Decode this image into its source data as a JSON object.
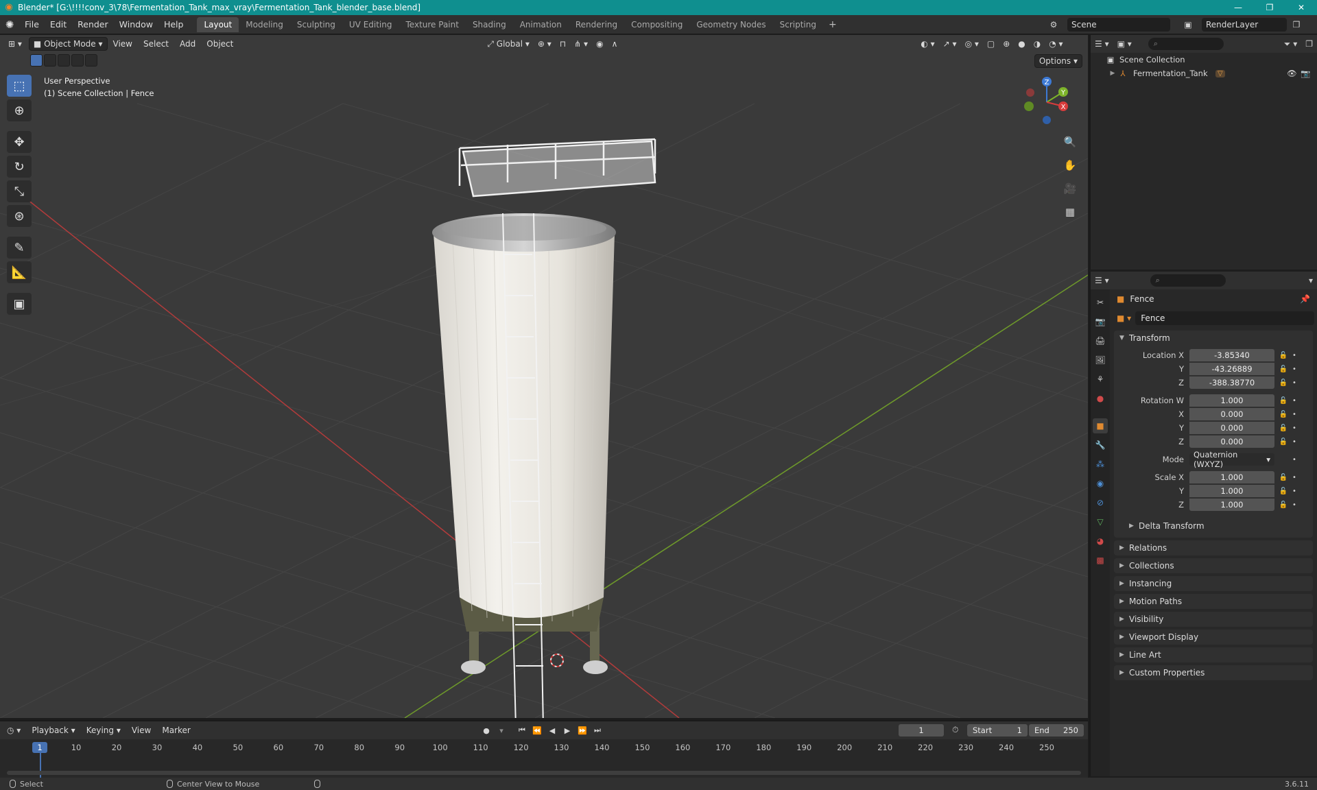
{
  "titlebar": {
    "title": "Blender* [G:\\!!!!conv_3\\78\\Fermentation_Tank_max_vray\\Fermentation_Tank_blender_base.blend]",
    "minimize": "—",
    "maximize": "❐",
    "close": "✕"
  },
  "menubar": {
    "items": [
      "File",
      "Edit",
      "Render",
      "Window",
      "Help"
    ],
    "workspaces": [
      "Layout",
      "Modeling",
      "Sculpting",
      "UV Editing",
      "Texture Paint",
      "Shading",
      "Animation",
      "Rendering",
      "Compositing",
      "Geometry Nodes",
      "Scripting"
    ],
    "add_workspace": "+",
    "scene": "Scene",
    "render_layer": "RenderLayer"
  },
  "viewport": {
    "mode": "Object Mode",
    "menus": [
      "View",
      "Select",
      "Add",
      "Object"
    ],
    "orientation": "Global",
    "options": "Options",
    "perspective": "User Perspective",
    "collection_info": "(1) Scene Collection | Fence",
    "gizmo": {
      "z": "Z",
      "y": "Y",
      "x": "X"
    }
  },
  "outliner": {
    "root": "Scene Collection",
    "items": [
      {
        "name": "Fermentation_Tank"
      }
    ]
  },
  "properties": {
    "object_name": "Fence",
    "data_name": "Fence",
    "transform": {
      "header": "Transform",
      "location_label": "Location X",
      "loc_x": "-3.85340",
      "loc_y": "-43.26889",
      "loc_z": "-388.38770",
      "rotation_label": "Rotation W",
      "rot_w": "1.000",
      "rot_x": "0.000",
      "rot_y": "0.000",
      "rot_z": "0.000",
      "mode_label": "Mode",
      "mode": "Quaternion (WXYZ)",
      "scale_label": "Scale X",
      "scale_x": "1.000",
      "scale_y": "1.000",
      "scale_z": "1.000",
      "y_label": "Y",
      "z_label": "Z",
      "x_label": "X",
      "delta": "Delta Transform"
    },
    "panels": [
      "Relations",
      "Collections",
      "Instancing",
      "Motion Paths",
      "Visibility",
      "Viewport Display",
      "Line Art",
      "Custom Properties"
    ]
  },
  "timeline": {
    "menus": [
      "Playback",
      "Keying",
      "View",
      "Marker"
    ],
    "current_frame": "1",
    "start_label": "Start",
    "start": "1",
    "end_label": "End",
    "end": "250",
    "ticks": [
      "1",
      "10",
      "20",
      "30",
      "40",
      "50",
      "60",
      "70",
      "80",
      "90",
      "100",
      "110",
      "120",
      "130",
      "140",
      "150",
      "160",
      "170",
      "180",
      "190",
      "200",
      "210",
      "220",
      "230",
      "240",
      "250"
    ]
  },
  "statusbar": {
    "select": "Select",
    "center_view": "Center View to Mouse",
    "version": "3.6.11"
  }
}
